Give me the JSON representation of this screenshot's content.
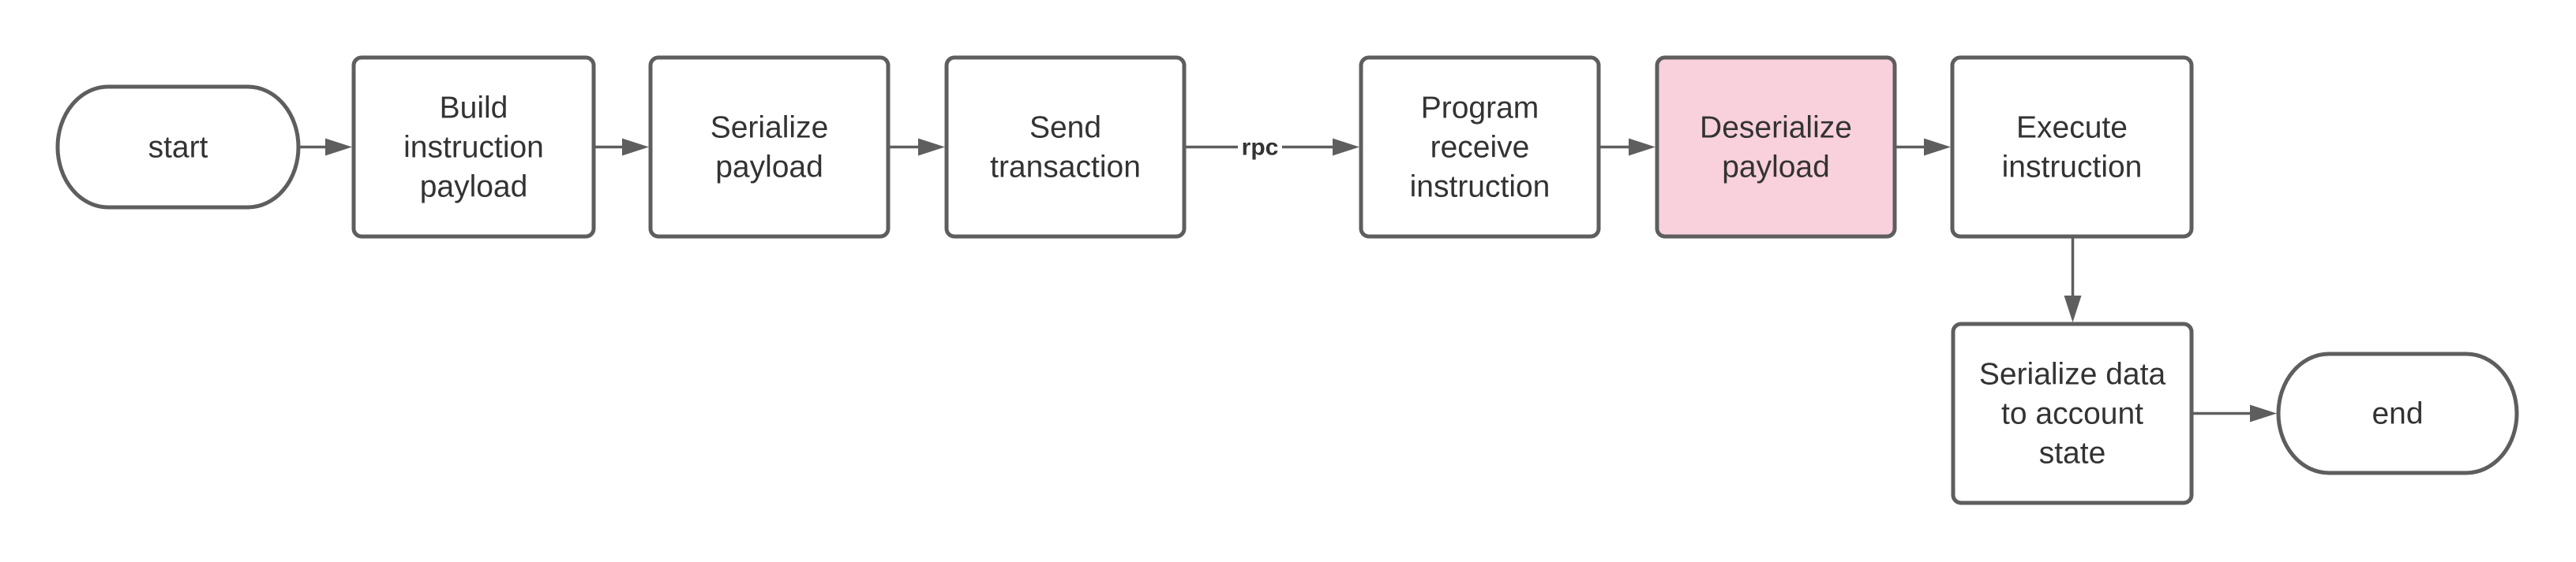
{
  "diagram": {
    "type": "flowchart",
    "colors": {
      "stroke": "#5e5e5e",
      "text": "#333333",
      "highlight_fill": "#f8d1dc",
      "default_fill": "#ffffff"
    },
    "nodes": [
      {
        "id": "start",
        "shape": "terminal",
        "lines": [
          "start"
        ],
        "highlighted": false
      },
      {
        "id": "build",
        "shape": "process",
        "lines": [
          "Build",
          "instruction",
          "payload"
        ],
        "highlighted": false
      },
      {
        "id": "serialize",
        "shape": "process",
        "lines": [
          "Serialize",
          "payload"
        ],
        "highlighted": false
      },
      {
        "id": "send",
        "shape": "process",
        "lines": [
          "Send",
          "transaction"
        ],
        "highlighted": false
      },
      {
        "id": "program",
        "shape": "process",
        "lines": [
          "Program",
          "receive",
          "instruction"
        ],
        "highlighted": false
      },
      {
        "id": "deserialize",
        "shape": "process",
        "lines": [
          "Deserialize",
          "payload"
        ],
        "highlighted": true
      },
      {
        "id": "execute",
        "shape": "process",
        "lines": [
          "Execute",
          "instruction"
        ],
        "highlighted": false
      },
      {
        "id": "serialize_state",
        "shape": "process",
        "lines": [
          "Serialize data",
          "to account",
          "state"
        ],
        "highlighted": false
      },
      {
        "id": "end",
        "shape": "terminal",
        "lines": [
          "end"
        ],
        "highlighted": false
      }
    ],
    "edges": [
      {
        "from": "start",
        "to": "build",
        "label": ""
      },
      {
        "from": "build",
        "to": "serialize",
        "label": ""
      },
      {
        "from": "serialize",
        "to": "send",
        "label": ""
      },
      {
        "from": "send",
        "to": "program",
        "label": "rpc"
      },
      {
        "from": "program",
        "to": "deserialize",
        "label": ""
      },
      {
        "from": "deserialize",
        "to": "execute",
        "label": ""
      },
      {
        "from": "execute",
        "to": "serialize_state",
        "label": ""
      },
      {
        "from": "serialize_state",
        "to": "end",
        "label": ""
      }
    ]
  }
}
